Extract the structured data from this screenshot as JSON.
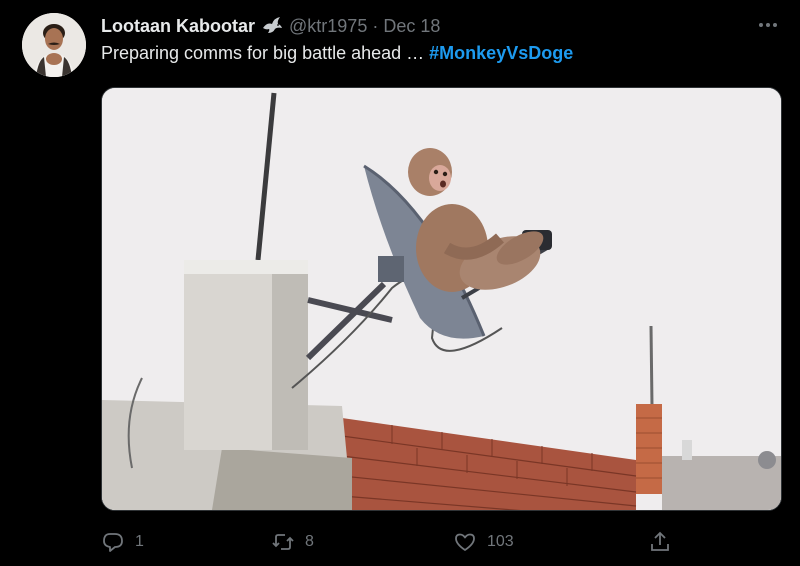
{
  "tweet": {
    "author": {
      "name": "Lootaan Kabootar",
      "badge_icon": "dove-icon",
      "handle": "@ktr1975",
      "separator": "·",
      "date": "Dec 18"
    },
    "text": "Preparing comms for big battle ahead …",
    "hashtag": "#MonkeyVsDoge",
    "media": {
      "alt": "Monkey sitting on a satellite dish on a rooftop"
    },
    "actions": {
      "reply": {
        "icon": "reply-icon",
        "count": "1"
      },
      "retweet": {
        "icon": "retweet-icon",
        "count": "8"
      },
      "like": {
        "icon": "heart-icon",
        "count": "103"
      },
      "share": {
        "icon": "share-icon"
      }
    },
    "more_icon": "more-icon"
  },
  "colors": {
    "background": "#000000",
    "text": "#e7e9ea",
    "secondary": "#71767b",
    "link": "#1d9bf0"
  }
}
